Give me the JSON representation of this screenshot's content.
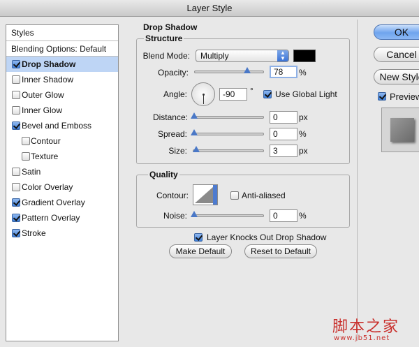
{
  "window": {
    "title": "Layer Style"
  },
  "styles_list": {
    "header": "Styles",
    "blending_options": "Blending Options: Default",
    "items": [
      {
        "label": "Drop Shadow",
        "checked": true,
        "selected": true,
        "sub": false
      },
      {
        "label": "Inner Shadow",
        "checked": false,
        "selected": false,
        "sub": false
      },
      {
        "label": "Outer Glow",
        "checked": false,
        "selected": false,
        "sub": false
      },
      {
        "label": "Inner Glow",
        "checked": false,
        "selected": false,
        "sub": false
      },
      {
        "label": "Bevel and Emboss",
        "checked": true,
        "selected": false,
        "sub": false
      },
      {
        "label": "Contour",
        "checked": false,
        "selected": false,
        "sub": true
      },
      {
        "label": "Texture",
        "checked": false,
        "selected": false,
        "sub": true
      },
      {
        "label": "Satin",
        "checked": false,
        "selected": false,
        "sub": false
      },
      {
        "label": "Color Overlay",
        "checked": false,
        "selected": false,
        "sub": false
      },
      {
        "label": "Gradient Overlay",
        "checked": true,
        "selected": false,
        "sub": false
      },
      {
        "label": "Pattern Overlay",
        "checked": true,
        "selected": false,
        "sub": false
      },
      {
        "label": "Stroke",
        "checked": true,
        "selected": false,
        "sub": false
      }
    ]
  },
  "drop_shadow": {
    "title": "Drop Shadow",
    "structure": {
      "title": "Structure",
      "blend_mode_label": "Blend Mode:",
      "blend_mode_value": "Multiply",
      "shadow_color": "#000000",
      "opacity_label": "Opacity:",
      "opacity_value": "78",
      "opacity_unit": "%",
      "angle_label": "Angle:",
      "angle_value": "-90",
      "angle_unit": "°",
      "use_global_light_label": "Use Global Light",
      "use_global_light_checked": true,
      "distance_label": "Distance:",
      "distance_value": "0",
      "distance_unit": "px",
      "spread_label": "Spread:",
      "spread_value": "0",
      "spread_unit": "%",
      "size_label": "Size:",
      "size_value": "3",
      "size_unit": "px"
    },
    "quality": {
      "title": "Quality",
      "contour_label": "Contour:",
      "anti_aliased_label": "Anti-aliased",
      "anti_aliased_checked": false,
      "noise_label": "Noise:",
      "noise_value": "0",
      "noise_unit": "%"
    },
    "layer_knocks_out_label": "Layer Knocks Out Drop Shadow",
    "layer_knocks_out_checked": true,
    "make_default_label": "Make Default",
    "reset_to_default_label": "Reset to Default"
  },
  "side_buttons": {
    "ok_label": "OK",
    "cancel_label": "Cancel",
    "new_style_label": "New Style",
    "preview_label": "Preview",
    "preview_checked": true
  },
  "watermark": {
    "text": "脚本之家",
    "url": "www.jb51.net"
  }
}
